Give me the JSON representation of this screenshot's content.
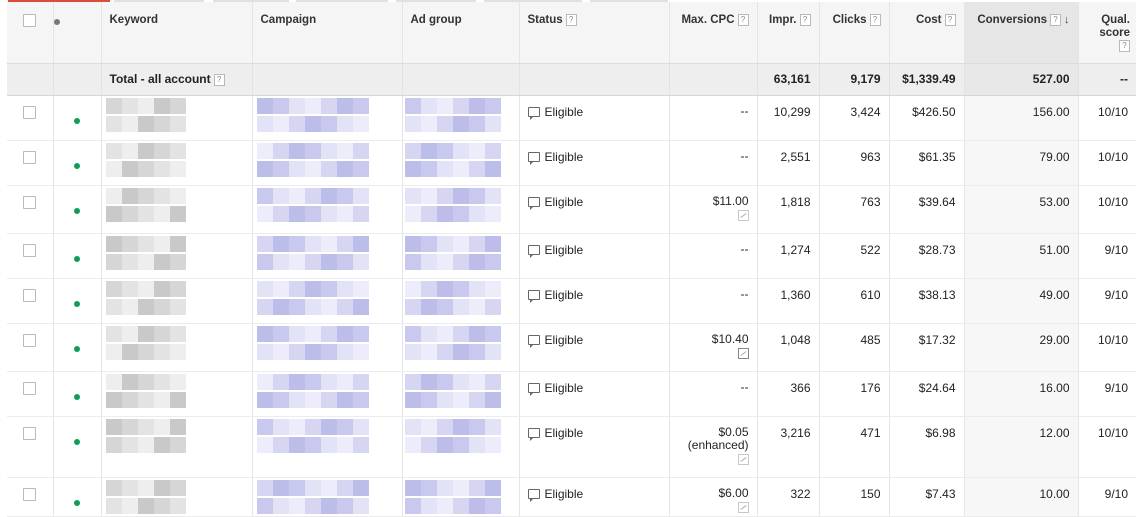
{
  "headers": {
    "keyword": "Keyword",
    "campaign": "Campaign",
    "ad_group": "Ad group",
    "status": "Status",
    "max_cpc": "Max. CPC",
    "impr": "Impr.",
    "clicks": "Clicks",
    "cost": "Cost",
    "conversions": "Conversions",
    "qual_score": "Qual. score",
    "help_glyph": "?",
    "sort_glyph": "↓"
  },
  "total": {
    "label": "Total - all account",
    "impr": "63,161",
    "clicks": "9,179",
    "cost": "$1,339.49",
    "conversions": "527.00",
    "qual_score": "--"
  },
  "rows": [
    {
      "status": "Eligible",
      "max_cpc": "--",
      "impr": "10,299",
      "clicks": "3,424",
      "cost": "$426.50",
      "conversions": "156.00",
      "qual_score": "10/10",
      "cpc_icon": false
    },
    {
      "status": "Eligible",
      "max_cpc": "--",
      "impr": "2,551",
      "clicks": "963",
      "cost": "$61.35",
      "conversions": "79.00",
      "qual_score": "10/10",
      "cpc_icon": false
    },
    {
      "status": "Eligible",
      "max_cpc": "$11.00",
      "impr": "1,818",
      "clicks": "763",
      "cost": "$39.64",
      "conversions": "53.00",
      "qual_score": "10/10",
      "cpc_icon": true
    },
    {
      "status": "Eligible",
      "max_cpc": "--",
      "impr": "1,274",
      "clicks": "522",
      "cost": "$28.73",
      "conversions": "51.00",
      "qual_score": "9/10",
      "cpc_icon": false
    },
    {
      "status": "Eligible",
      "max_cpc": "--",
      "impr": "1,360",
      "clicks": "610",
      "cost": "$38.13",
      "conversions": "49.00",
      "qual_score": "9/10",
      "cpc_icon": false
    },
    {
      "status": "Eligible",
      "max_cpc": "$10.40",
      "impr": "1,048",
      "clicks": "485",
      "cost": "$17.32",
      "conversions": "29.00",
      "qual_score": "10/10",
      "cpc_icon": true
    },
    {
      "status": "Eligible",
      "max_cpc": "--",
      "impr": "366",
      "clicks": "176",
      "cost": "$24.64",
      "conversions": "16.00",
      "qual_score": "9/10",
      "cpc_icon": false
    },
    {
      "status": "Eligible",
      "max_cpc": "$0.05",
      "max_cpc_note": "(enhanced)",
      "impr": "3,216",
      "clicks": "471",
      "cost": "$6.98",
      "conversions": "12.00",
      "qual_score": "10/10",
      "cpc_icon": true
    },
    {
      "status": "Eligible",
      "max_cpc": "$6.00",
      "impr": "322",
      "clicks": "150",
      "cost": "$7.43",
      "conversions": "10.00",
      "qual_score": "9/10",
      "cpc_icon": true
    }
  ],
  "icons": {
    "status_icon": "speech-bubble-icon",
    "row_status_dot": "green-dot-icon",
    "cpc_icon": "bid-chart-icon"
  },
  "colors": {
    "enabled_dot": "#0f9d58",
    "header_bg": "#f5f5f5",
    "total_bg": "#eeeeee",
    "active_tab": "#dd4b39"
  }
}
